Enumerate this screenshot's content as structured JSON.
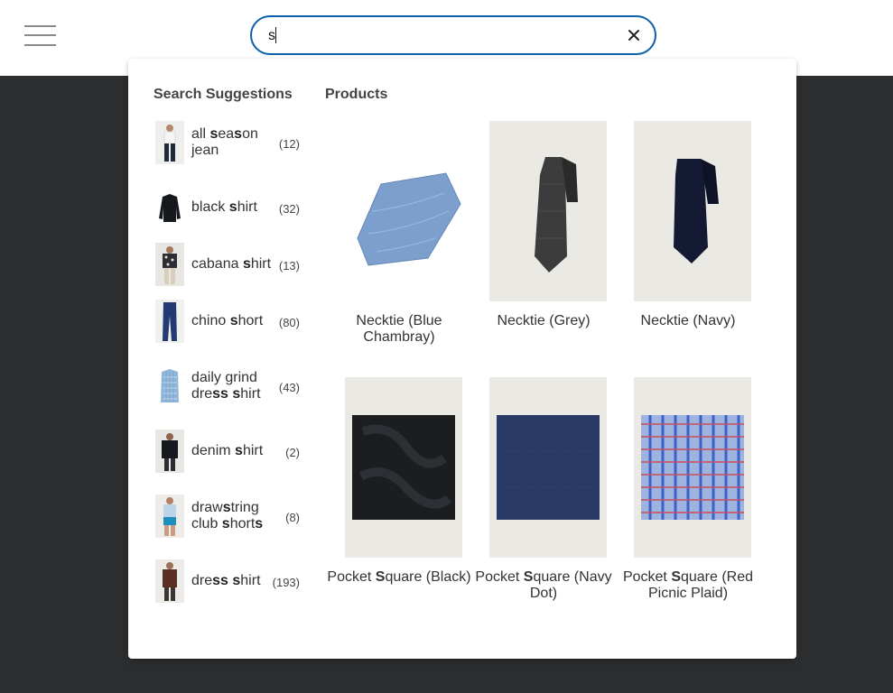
{
  "search": {
    "query": "s"
  },
  "panel": {
    "suggestions_title": "Search Suggestions",
    "products_title": "Products"
  },
  "suggestions": [
    {
      "pre": "all ",
      "b1": "s",
      "mid": "ea",
      "b2": "s",
      "post": "on jean",
      "count": "(12)"
    },
    {
      "pre": "black ",
      "b1": "s",
      "mid": "hirt",
      "b2": "",
      "post": "",
      "count": "(32)"
    },
    {
      "pre": "cabana ",
      "b1": "s",
      "mid": "hirt",
      "b2": "",
      "post": "",
      "count": "(13)"
    },
    {
      "pre": "chino ",
      "b1": "s",
      "mid": "hort",
      "b2": "",
      "post": "",
      "count": "(80)"
    },
    {
      "pre": "daily grind dre",
      "b1": "ss",
      "mid": " ",
      "b2": "s",
      "post": "hirt",
      "count": "(43)"
    },
    {
      "pre": "denim ",
      "b1": "s",
      "mid": "hirt",
      "b2": "",
      "post": "",
      "count": "(2)"
    },
    {
      "pre": "draw",
      "b1": "s",
      "mid": "tring club ",
      "b2": "s",
      "post": "hort",
      "b3": "s",
      "count": "(8)"
    },
    {
      "pre": "dre",
      "b1": "ss",
      "mid": " ",
      "b2": "s",
      "post": "hirt",
      "count": "(193)"
    }
  ],
  "products": [
    {
      "pre": "Necktie (Blue Chambray)",
      "b": "",
      "post": ""
    },
    {
      "pre": "Necktie (Grey)",
      "b": "",
      "post": ""
    },
    {
      "pre": "Necktie (Navy)",
      "b": "",
      "post": ""
    },
    {
      "pre": "Pocket ",
      "b": "S",
      "post": "quare (Black)"
    },
    {
      "pre": "Pocket ",
      "b": "S",
      "post": "quare (Navy Dot)"
    },
    {
      "pre": "Pocket ",
      "b": "S",
      "post": "quare (Red Picnic Plaid)"
    }
  ],
  "colors": {
    "accent": "#0b5fab",
    "overlay": "#2b2d2f"
  },
  "icons": {
    "menu": "hamburger-icon",
    "clear": "close-icon"
  }
}
